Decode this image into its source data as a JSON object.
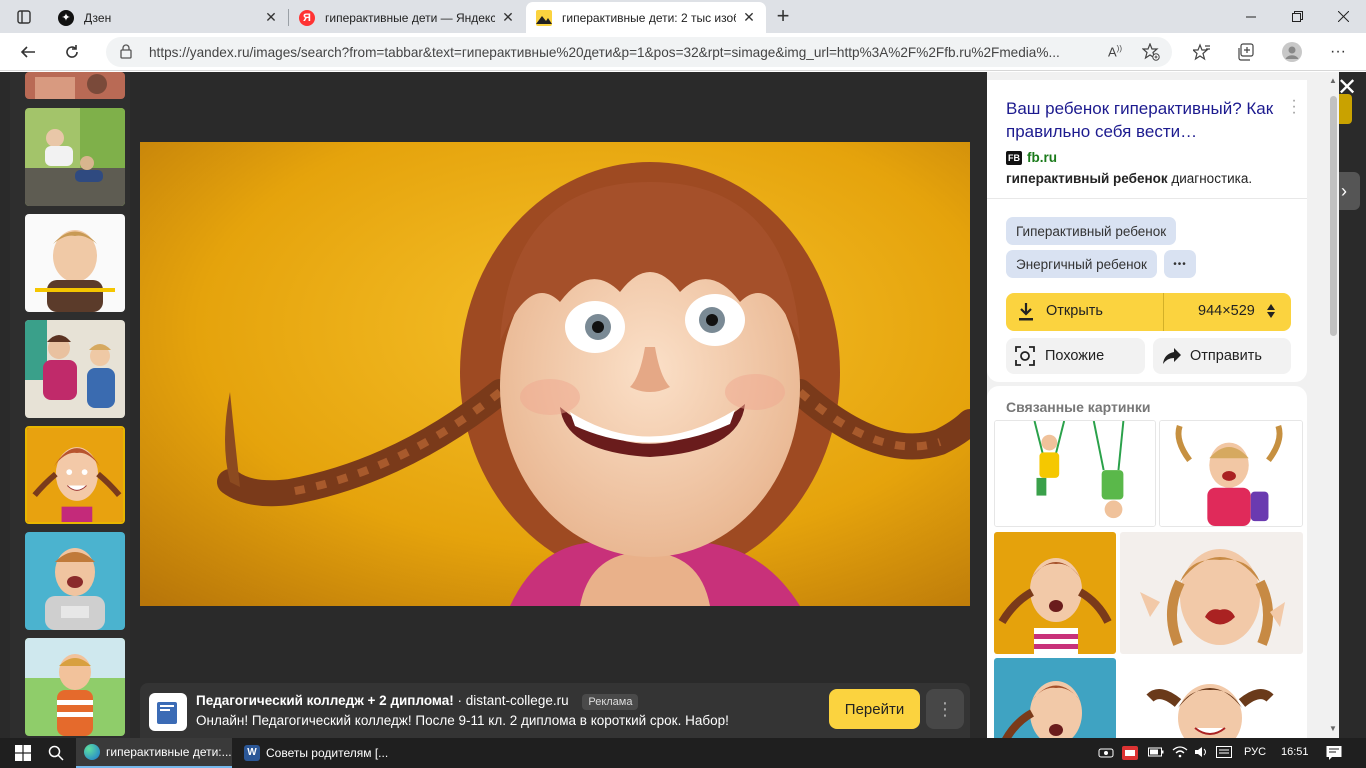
{
  "browser": {
    "tabs": [
      {
        "title": "Дзен",
        "active": false
      },
      {
        "title": "гиперактивные дети — Яндекс",
        "active": false
      },
      {
        "title": "гиперактивные дети: 2 тыс изоб",
        "active": true
      }
    ],
    "url": "https://yandex.ru/images/search?from=tabbar&text=гиперактивные%20дети&p=1&pos=32&rpt=simage&img_url=http%3A%2F%2Ffb.ru%2Fmedia%..."
  },
  "panel": {
    "title": "Ваш ребенок гиперактивный? Как правильно себя вести…",
    "source_logo": "FB",
    "source": "fb.ru",
    "desc_bold": "гиперактивный ребенок",
    "desc_rest": " диагностика.",
    "tags": [
      "Гиперактивный ребенок",
      "Энергичный ребенок"
    ],
    "tags_more": "•••",
    "open_label": "Открыть",
    "size_label": "944×529",
    "similar_label": "Похожие",
    "share_label": "Отправить",
    "related_title": "Связанные картинки"
  },
  "ad": {
    "title": "Педагогический колледж + 2 диплома!",
    "domain": "distant-college.ru",
    "badge": "Реклама",
    "text": "Онлайн! Педагогический колледж! После 9-11 кл. 2 диплома в короткий срок. Набор!",
    "button": "Перейти",
    "separator": "·"
  },
  "taskbar": {
    "apps": [
      {
        "title": "гиперактивные дети:...",
        "active": true
      },
      {
        "title": "Советы родителям [...",
        "active": false
      }
    ],
    "language": "РУС",
    "time": "16:51"
  },
  "colors": {
    "accent_yellow": "#fbd33f",
    "panel_link": "#1d1b8f",
    "source_green": "#1a7a1a",
    "viewer_bg": "#2a2a2a"
  }
}
